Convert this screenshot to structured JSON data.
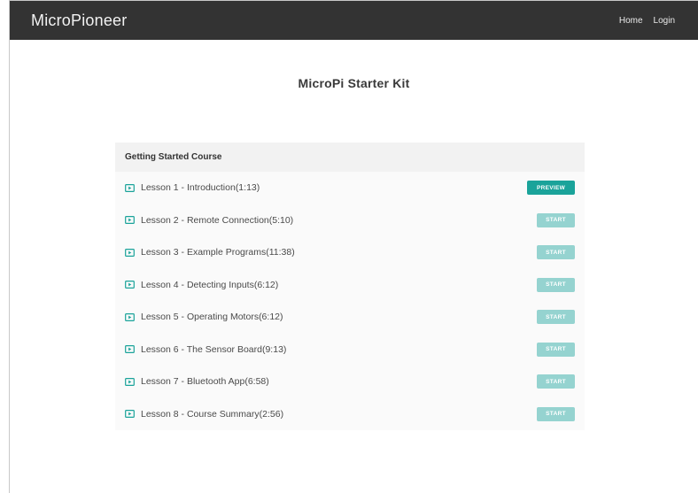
{
  "navbar": {
    "brand": "MicroPioneer",
    "links": [
      "Home",
      "Login"
    ]
  },
  "page": {
    "title": "MicroPi Starter Kit"
  },
  "course": {
    "header": "Getting Started Course",
    "lessons": [
      {
        "title": "Lesson 1 - Introduction(1:13)",
        "action": "PREVIEW"
      },
      {
        "title": "Lesson 2 - Remote Connection(5:10)",
        "action": "START"
      },
      {
        "title": "Lesson 3 - Example Programs(11:38)",
        "action": "START"
      },
      {
        "title": "Lesson 4 - Detecting Inputs(6:12)",
        "action": "START"
      },
      {
        "title": "Lesson 5 - Operating Motors(6:12)",
        "action": "START"
      },
      {
        "title": "Lesson 6 - The Sensor Board(9:13)",
        "action": "START"
      },
      {
        "title": "Lesson 7 - Bluetooth App(6:58)",
        "action": "START"
      },
      {
        "title": "Lesson 8 - Course Summary(2:56)",
        "action": "START"
      }
    ]
  },
  "colors": {
    "navbar_bg": "#333333",
    "preview_button": "#1aa39a",
    "start_button": "#95d3d0",
    "icon": "#1aa39a"
  },
  "icons": {
    "lesson": "video-icon"
  }
}
